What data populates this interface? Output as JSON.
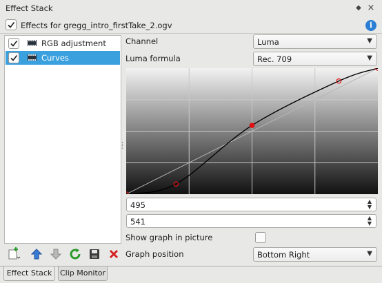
{
  "window": {
    "title": "Effect Stack",
    "float_glyph": "◆",
    "close_glyph": "×"
  },
  "header": {
    "effects_label": "Effects for gregg_intro_firstTake_2.ogv",
    "enabled": true,
    "info_icon": "info-icon"
  },
  "effects": [
    {
      "label": "RGB adjustment",
      "enabled": true,
      "selected": false,
      "icon": "film-icon"
    },
    {
      "label": "Curves",
      "enabled": true,
      "selected": true,
      "icon": "film-icon"
    }
  ],
  "params": {
    "channel_label": "Channel",
    "channel_value": "Luma",
    "luma_formula_label": "Luma formula",
    "luma_formula_value": "Rec. 709",
    "input_value": "495",
    "output_value": "541",
    "show_graph_label": "Show graph in picture",
    "show_graph_checked": false,
    "graph_position_label": "Graph position",
    "graph_position_value": "Bottom Right"
  },
  "curve": {
    "grid_divisions": 4,
    "points": [
      [
        0.0,
        0.0
      ],
      [
        0.198,
        0.081
      ],
      [
        0.5,
        0.546
      ],
      [
        0.845,
        0.898
      ],
      [
        1.0,
        1.0
      ]
    ],
    "selected_point_index": 2
  },
  "toolbar": {
    "icons": [
      "add-effect-icon",
      "move-up-icon",
      "move-down-icon",
      "reset-icon",
      "save-icon",
      "delete-icon"
    ]
  },
  "tabs": [
    {
      "label": "Effect Stack",
      "active": true
    },
    {
      "label": "Clip Monitor",
      "active": false
    }
  ],
  "colors": {
    "selection": "#3aa0de",
    "curve_point": "#e01010",
    "info_blue": "#2a7fd4"
  }
}
